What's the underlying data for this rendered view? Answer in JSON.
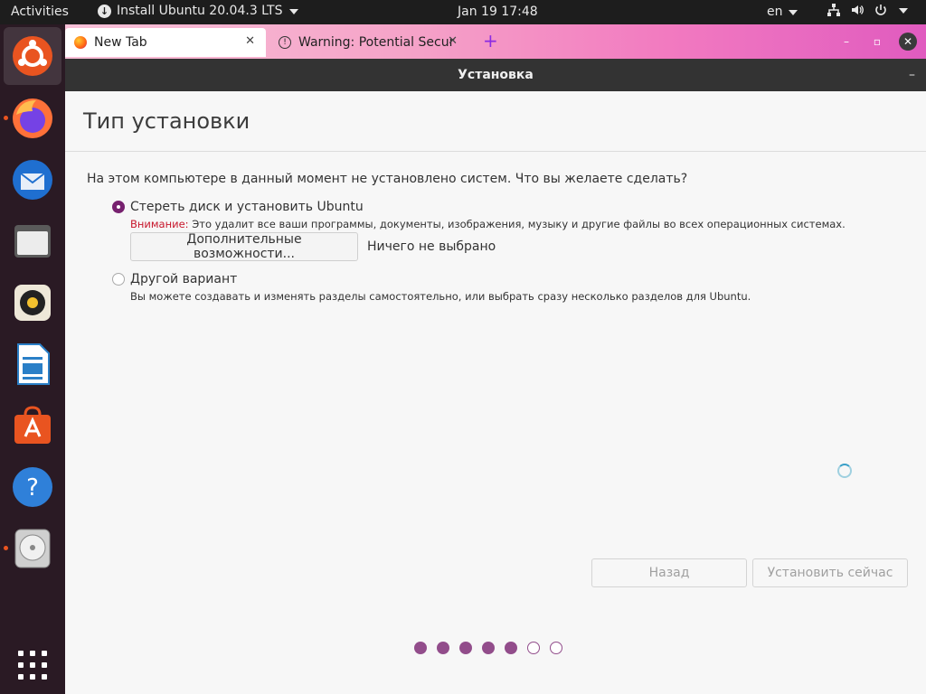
{
  "topbar": {
    "activities": "Activities",
    "app_menu": "Install Ubuntu 20.04.3 LTS",
    "clock": "Jan 19  17:48",
    "language": "en"
  },
  "browser": {
    "tabs": [
      {
        "label": "New Tab"
      },
      {
        "label": "Warning: Potential Secur"
      }
    ],
    "new_tab_symbol": "+"
  },
  "installer": {
    "window_title": "Установка",
    "page_title": "Тип установки",
    "question": "На этом компьютере в данный момент не установлено систем. Что вы желаете сделать?",
    "option_erase": {
      "label": "Стереть диск и установить Ubuntu",
      "warning_label": "Внимание:",
      "warning_text": " Это удалит все ваши программы, документы, изображения, музыку и другие файлы во всех операционных системах.",
      "advanced_button": "Дополнительные возможности...",
      "selection_status": "Ничего не выбрано",
      "checked": true
    },
    "option_other": {
      "label": "Другой вариант",
      "description": "Вы можете создавать и изменять разделы самостоятельно, или выбрать сразу несколько разделов для Ubuntu.",
      "checked": false
    },
    "back_button": "Назад",
    "install_button": "Установить сейчас",
    "progress": {
      "current_step": 5,
      "total_steps": 7
    }
  },
  "colors": {
    "accent": "#77216f",
    "ubuntu_orange": "#e95420",
    "warning_red": "#c7162b",
    "progress_dot": "#924d8b"
  },
  "icons": {
    "dock": [
      "ubuntu-installer-icon",
      "firefox-icon",
      "thunderbird-icon",
      "files-icon",
      "rhythmbox-icon",
      "libreoffice-writer-icon",
      "software-center-icon",
      "help-icon",
      "disks-icon",
      "app-grid-icon"
    ]
  }
}
